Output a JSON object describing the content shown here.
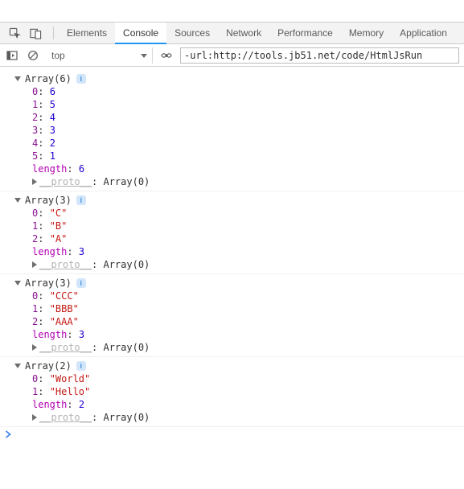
{
  "tabs": {
    "elements": "Elements",
    "console": "Console",
    "sources": "Sources",
    "network": "Network",
    "performance": "Performance",
    "memory": "Memory",
    "application": "Application"
  },
  "toolbar": {
    "context": "top",
    "filter_value": "-url:http://tools.jb51.net/code/HtmlJsRun"
  },
  "info_badge": "i",
  "length_label": "length",
  "proto_label": "__proto__",
  "proto_value": "Array(0)",
  "colon": ": ",
  "logs": [
    {
      "summary": "Array(6)",
      "items": [
        {
          "k": "0",
          "v": "6",
          "t": "num"
        },
        {
          "k": "1",
          "v": "5",
          "t": "num"
        },
        {
          "k": "2",
          "v": "4",
          "t": "num"
        },
        {
          "k": "3",
          "v": "3",
          "t": "num"
        },
        {
          "k": "4",
          "v": "2",
          "t": "num"
        },
        {
          "k": "5",
          "v": "1",
          "t": "num"
        }
      ],
      "length": "6"
    },
    {
      "summary": "Array(3)",
      "items": [
        {
          "k": "0",
          "v": "\"C\"",
          "t": "str"
        },
        {
          "k": "1",
          "v": "\"B\"",
          "t": "str"
        },
        {
          "k": "2",
          "v": "\"A\"",
          "t": "str"
        }
      ],
      "length": "3"
    },
    {
      "summary": "Array(3)",
      "items": [
        {
          "k": "0",
          "v": "\"CCC\"",
          "t": "str"
        },
        {
          "k": "1",
          "v": "\"BBB\"",
          "t": "str"
        },
        {
          "k": "2",
          "v": "\"AAA\"",
          "t": "str"
        }
      ],
      "length": "3"
    },
    {
      "summary": "Array(2)",
      "items": [
        {
          "k": "0",
          "v": "\"World\"",
          "t": "str"
        },
        {
          "k": "1",
          "v": "\"Hello\"",
          "t": "str"
        }
      ],
      "length": "2"
    }
  ]
}
